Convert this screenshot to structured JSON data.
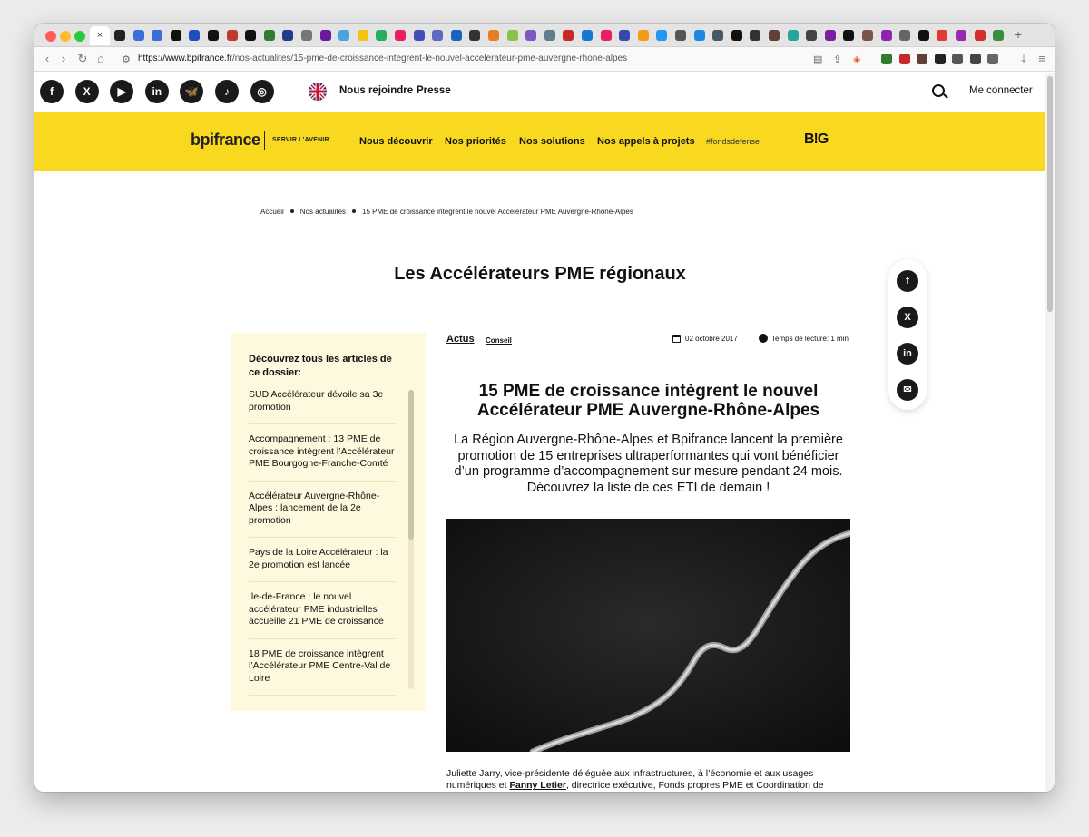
{
  "browser": {
    "active_tab_close": "×",
    "new_tab": "+",
    "url_host": "https://www.bpifrance.fr",
    "url_path": "/nos-actualites/15-pme-de-croissance-integrent-le-nouvel-accelerateur-pme-auvergne-rhone-alpes",
    "tab_favicon_colors": [
      "#222",
      "#3b6fd8",
      "#3b6fd8",
      "#111",
      "#1d4fc1",
      "#111",
      "#c0392b",
      "#111",
      "#2e7d32",
      "#223a8a",
      "#777",
      "#6a1b9a",
      "#4aa3df",
      "#f1c40f",
      "#27ae60",
      "#e91e63",
      "#3f51b5",
      "#5c6bc0",
      "#1565c0",
      "#333",
      "#e67e22",
      "#8bc34a",
      "#7e57c2",
      "#607d8b",
      "#c62828",
      "#1976d2",
      "#e91e63",
      "#3949ab",
      "#f39c12",
      "#2196f3",
      "#555",
      "#1e88e5",
      "#455a64",
      "#111",
      "#333",
      "#5d4037",
      "#26a69a",
      "#444",
      "#7b1fa2",
      "#111",
      "#795548",
      "#8e24aa",
      "#666",
      "#111",
      "#e53935",
      "#9c27b0",
      "#d32f2f",
      "#388e3c"
    ],
    "extension_colors": [
      "#2e7d32",
      "#c62828",
      "#5d4037",
      "#222",
      "#555",
      "#444",
      "#666"
    ]
  },
  "topbar": {
    "socials": [
      {
        "name": "facebook",
        "glyph": "f"
      },
      {
        "name": "x",
        "glyph": "X"
      },
      {
        "name": "youtube",
        "glyph": "▶"
      },
      {
        "name": "linkedin",
        "glyph": "in"
      },
      {
        "name": "bluesky",
        "glyph": "🦋"
      },
      {
        "name": "tiktok",
        "glyph": "♪"
      },
      {
        "name": "instagram",
        "glyph": "◎"
      }
    ],
    "join_label": "Nous rejoindre",
    "press_label": "Presse",
    "login_label": "Me connecter"
  },
  "header": {
    "logo": "bpifrance",
    "tagline": "SERVIR L'AVENIR",
    "nav": [
      "Nous découvrir",
      "Nos priorités",
      "Nos solutions",
      "Nos appels à projets"
    ],
    "hashtag": "#fondsdefense",
    "event_logo": "B!G"
  },
  "breadcrumb": {
    "home": "Accueil",
    "news": "Nos actualités",
    "current": "15 PME de croissance intègrent le nouvel Accélérateur PME Auvergne-Rhône-Alpes"
  },
  "section_title": "Les Accélérateurs PME régionaux",
  "share": [
    {
      "name": "facebook",
      "glyph": "f"
    },
    {
      "name": "x",
      "glyph": "X"
    },
    {
      "name": "linkedin",
      "glyph": "in"
    },
    {
      "name": "email",
      "glyph": "✉"
    }
  ],
  "sidebar": {
    "title": "Découvrez tous les articles de ce dossier:",
    "items": [
      "SUD Accélérateur dévoile sa 3e promotion",
      "Accompagnement : 13 PME de croissance intègrent l’Accélérateur PME Bourgogne-Franche-Comté",
      "Accélérateur Auvergne-Rhône-Alpes : lancement de la 2e promotion",
      "Pays de la Loire Accélérateur : la 2e promotion est lancée",
      "Ile-de-France : le nouvel accélérateur PME industrielles accueille 21 PME de croissance",
      "18 PME de croissance intègrent l’Accélérateur PME Centre-Val de Loire"
    ]
  },
  "article": {
    "category": "Actus",
    "tag": "Conseil",
    "date": "02 octobre 2017",
    "reading_time": "Temps de lecture: 1 min",
    "title": "15 PME de croissance intègrent le nouvel Accélérateur PME Auvergne-Rhône-Alpes",
    "lede": "La Région Auvergne-Rhône-Alpes et Bpifrance lancent la première promotion de 15 entreprises ultraperformantes qui vont bénéficier d’un programme d’accompagnement sur mesure pendant 24 mois. Découvrez la liste de ces ETI de demain !",
    "body_part1": "Juliette Jarry, vice-présidente déléguée aux infrastructures, à l’économie et aux usages numériques et ",
    "body_link": "Fanny Letier",
    "body_part2": ", directrice exécutive, Fonds propres PME et Coordination de l’Accompagnement chez Bpifrance, ont révélé le nom des entreprises retenues pour intégrer l’Accélérateur PME Auvergne-Rhône-Alpes."
  }
}
